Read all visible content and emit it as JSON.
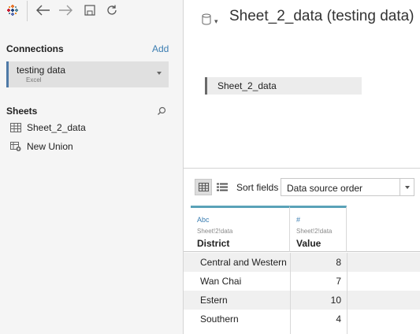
{
  "toolbar": {
    "logo_icon": "tableau-logo-icon",
    "back_icon": "arrow-left-icon",
    "forward_icon": "arrow-right-icon",
    "save_icon": "save-icon",
    "refresh_icon": "refresh-icon"
  },
  "connections": {
    "heading": "Connections",
    "add_label": "Add",
    "items": [
      {
        "name": "testing data",
        "type": "Excel"
      }
    ]
  },
  "sheets": {
    "heading": "Sheets",
    "items": [
      {
        "label": "Sheet_2_data",
        "icon": "table-icon"
      },
      {
        "label": "New Union",
        "icon": "union-icon"
      }
    ]
  },
  "datasource": {
    "title": "Sheet_2_data (testing data)",
    "icon": "database-icon"
  },
  "canvas": {
    "table_label": "Sheet_2_data"
  },
  "grid_toolbar": {
    "sort_label": "Sort fields",
    "sort_value": "Data source order"
  },
  "grid": {
    "columns": [
      {
        "type": "Abc",
        "source": "Sheet!2!data",
        "name": "District"
      },
      {
        "type": "#",
        "source": "Sheet!2!data",
        "name": "Value"
      }
    ],
    "rows": [
      {
        "district": "Central and Western",
        "value": "8"
      },
      {
        "district": "Wan Chai",
        "value": "7"
      },
      {
        "district": "Estern",
        "value": "10"
      },
      {
        "district": "Southern",
        "value": "4"
      }
    ]
  },
  "colors": {
    "accent": "#4e79a7",
    "column_header_accent": "#5aa2b8",
    "link": "#3c7eb2"
  }
}
